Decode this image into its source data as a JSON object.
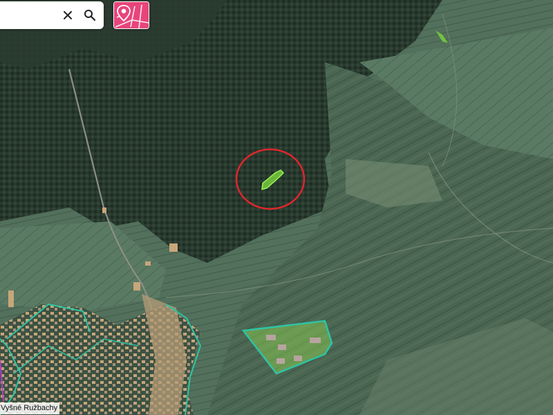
{
  "search": {
    "value": "",
    "placeholder": ""
  },
  "icons": {
    "clear": "close-icon",
    "search": "search-icon",
    "parcel_tool": "map-pin-parcel-icon"
  },
  "colors": {
    "parcel_button_bg": "#e8457c",
    "highlight_circle": "#e0262c",
    "selected_parcel": "#7cd63b",
    "boundary": "#2ec4a4",
    "village": "#b59c77"
  },
  "map": {
    "place_label": "Vyšné Ružbachy"
  }
}
